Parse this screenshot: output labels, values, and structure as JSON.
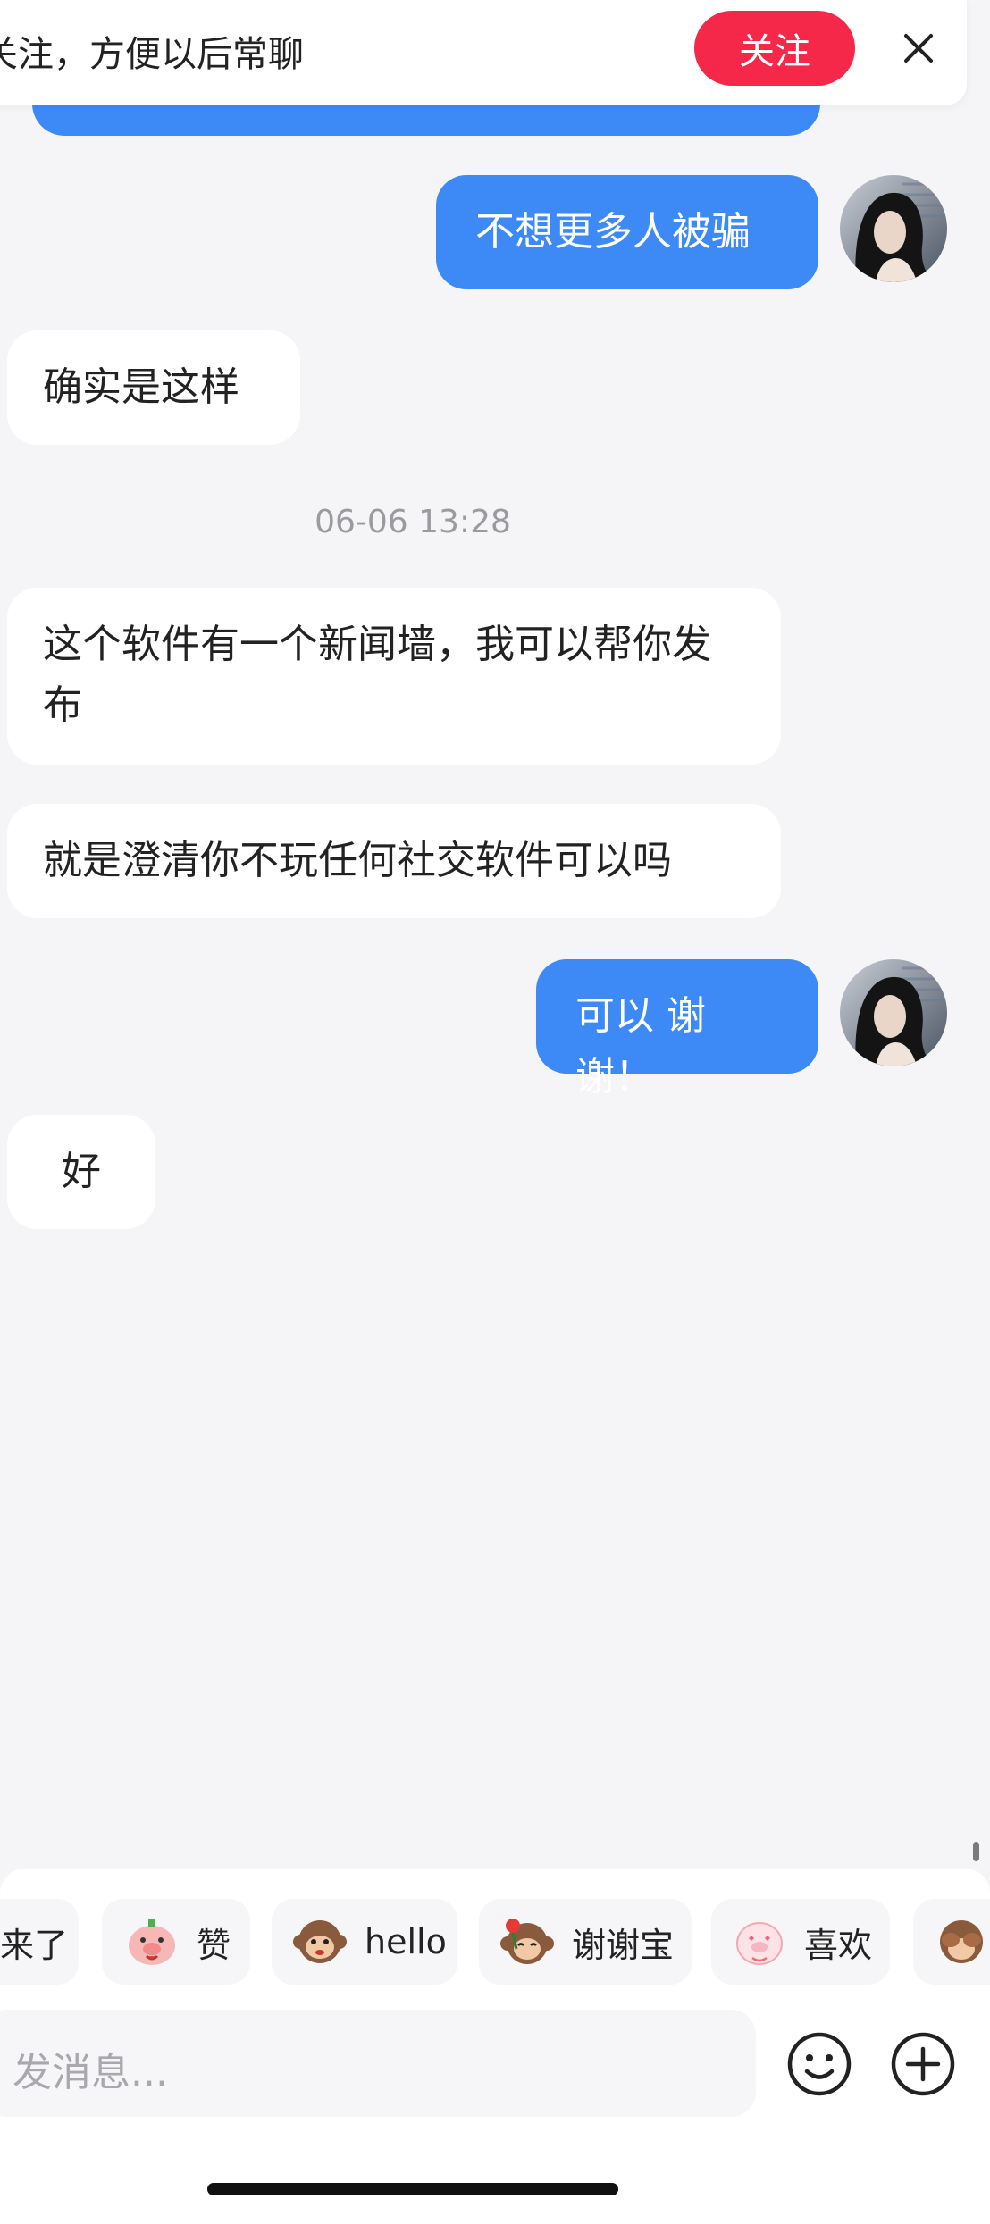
{
  "banner": {
    "text": "关注，方便以后常聊",
    "follow_label": "关注",
    "close_icon": "close-icon"
  },
  "messages": [
    {
      "side": "right",
      "text": "不想更多人被骗"
    },
    {
      "side": "left",
      "text": "确实是这样"
    },
    {
      "side": "left",
      "text": "这个软件有一个新闻墙，我可以帮你发布"
    },
    {
      "side": "left",
      "text": "就是澄清你不玩任何社交软件可以吗"
    },
    {
      "side": "right",
      "text": "可以 谢谢！"
    },
    {
      "side": "left",
      "text": "好"
    }
  ],
  "timestamp": "06-06 13:28",
  "quick_replies": [
    {
      "label": "来了",
      "icon": "sticker-icon"
    },
    {
      "label": "赞",
      "icon": "pig-sticker-icon"
    },
    {
      "label": "hello",
      "icon": "monkey-sticker-icon"
    },
    {
      "label": "谢谢宝",
      "icon": "monkey-rose-sticker-icon"
    },
    {
      "label": "喜欢",
      "icon": "pig-love-sticker-icon"
    },
    {
      "label": "",
      "icon": "monkey-cover-eyes-icon"
    }
  ],
  "composer": {
    "placeholder": "发消息...",
    "emoji_icon": "emoji-icon",
    "add_icon": "plus-circle-icon"
  },
  "colors": {
    "blue_bubble": "#3d8af7",
    "follow_red": "#f5284a",
    "background": "#f5f5f7"
  }
}
